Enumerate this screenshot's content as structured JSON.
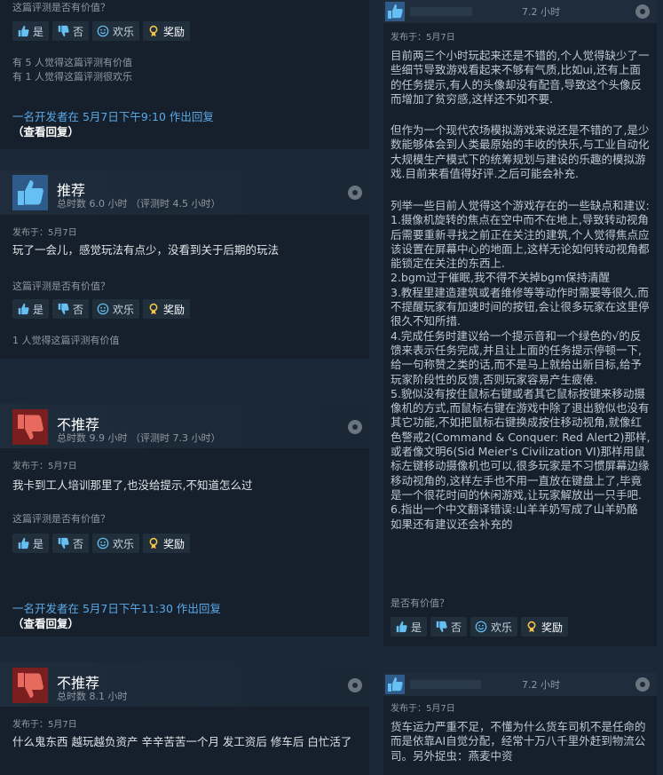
{
  "vote_labels": {
    "yes": "是",
    "no": "否",
    "funny": "欢乐",
    "award": "奖励"
  },
  "left": {
    "review0": {
      "question": "这篇评测是否有价值？",
      "helpful_line1": "有 5 人觉得这篇评测有价值",
      "helpful_line2": "有 1 人觉得这篇评测很欢乐",
      "dev_reply": "一名开发者在 5月7日下午9:10 作出回复",
      "view_reply": "（查看回复）"
    },
    "review1": {
      "verdict": "推荐",
      "hours": "总时数 6.0 小时 （评测时 4.5 小时）",
      "posted": "发布于：5月7日",
      "body": "玩了一会儿，感觉玩法有点少，没看到关于后期的玩法",
      "question": "这篇评测是否有价值？",
      "helpful": "1 人觉得这篇评测有价值"
    },
    "review2": {
      "verdict": "不推荐",
      "hours": "总时数 9.9 小时 （评测时 7.3 小时）",
      "posted": "发布于：5月7日",
      "body": "我卡到工人培训那里了,也没给提示,不知道怎么过",
      "question": "这篇评测是否有价值？",
      "dev_reply": "一名开发者在 5月7日下午11:30 作出回复",
      "view_reply": "（查看回复）"
    },
    "review3": {
      "verdict": "不推荐",
      "hours": "总时数 8.1 小时",
      "posted": "发布于：5月7日",
      "body": "什么鬼东西 越玩越负资产 辛辛苦苦一个月 发工资后 修车后 白忙活了"
    }
  },
  "right": {
    "review1": {
      "hours": "7.2 小时",
      "posted": "发布于：5月7日",
      "paragraphs": [
        "目前两三个小时玩起来还是不错的,个人觉得缺少了一些细节导致游戏看起来不够有气质,比如ui,还有上面的任务提示,有人的头像却没有配音,导致这个头像反而增加了贫穷感,这样还不如不要.",
        "但作为一个现代农场模拟游戏来说还是不错的了,是少数能够体会到人类最原始的丰收的快乐,与工业自动化大规模生产模式下的统筹规划与建设的乐趣的模拟游戏.目前来看值得好评.之后可能会补充.",
        "列举一些目前人觉得这个游戏存在的一些缺点和建议:\n1.摄像机旋转的焦点在空中而不在地上,导致转动视角后需要重新寻找之前正在关注的建筑,个人觉得焦点应该设置在屏幕中心的地面上,这样无论如何转动视角都能锁定在关注的东西上.\n2.bgm过于催眠,我不得不关掉bgm保持清醒\n3.教程里建造建筑或者维修等等动作时需要等很久,而不提醒玩家有加速时间的按钮,会让很多玩家在这里停很久不知所措.\n4.完成任务时建议给一个提示音和一个绿色的√的反馈来表示任务完成,并且让上面的任务提示停顿一下,给一句称赞之类的话,而不是马上就给出新目标,给予玩家阶段性的反馈,否则玩家容易产生疲倦.\n5.貌似没有按住鼠标右键或者其它鼠标按键来移动摄像机的方式,而鼠标右键在游戏中除了退出貌似也没有其它功能,不如把鼠标右键换成按住移动视角,就像红色警戒2(Command & Conquer: Red Alert2)那样,或者像文明6(Sid Meier's Civilization VI)那样用鼠标左键移动摄像机也可以,很多玩家是不习惯屏幕边缘移动视角的,这样左手也不用一直放在键盘上了,毕竟是一个很花时间的休闲游戏,让玩家解放出一只手吧.\n6.指出一个中文翻译错误:山羊羊奶写成了山羊奶酪\n如果还有建议还会补充的"
      ],
      "question": "是否有价值？"
    },
    "review2": {
      "hours": "7.2 小时",
      "posted": "发布于：5月7日",
      "body": "货车运力严重不足，不懂为什么货车司机不是任命的而是依靠AI自觉分配，经常十万八千里外赶到物流公司。另外捉虫：燕麦中资"
    }
  },
  "colors": {
    "recommend": "#4a7ab5",
    "not_recommend": "#9a2c2c",
    "link": "#5aa9e6"
  },
  "icons": [
    "thumbs-up-icon",
    "thumbs-down-icon",
    "smile-icon",
    "award-icon",
    "steam-icon"
  ]
}
